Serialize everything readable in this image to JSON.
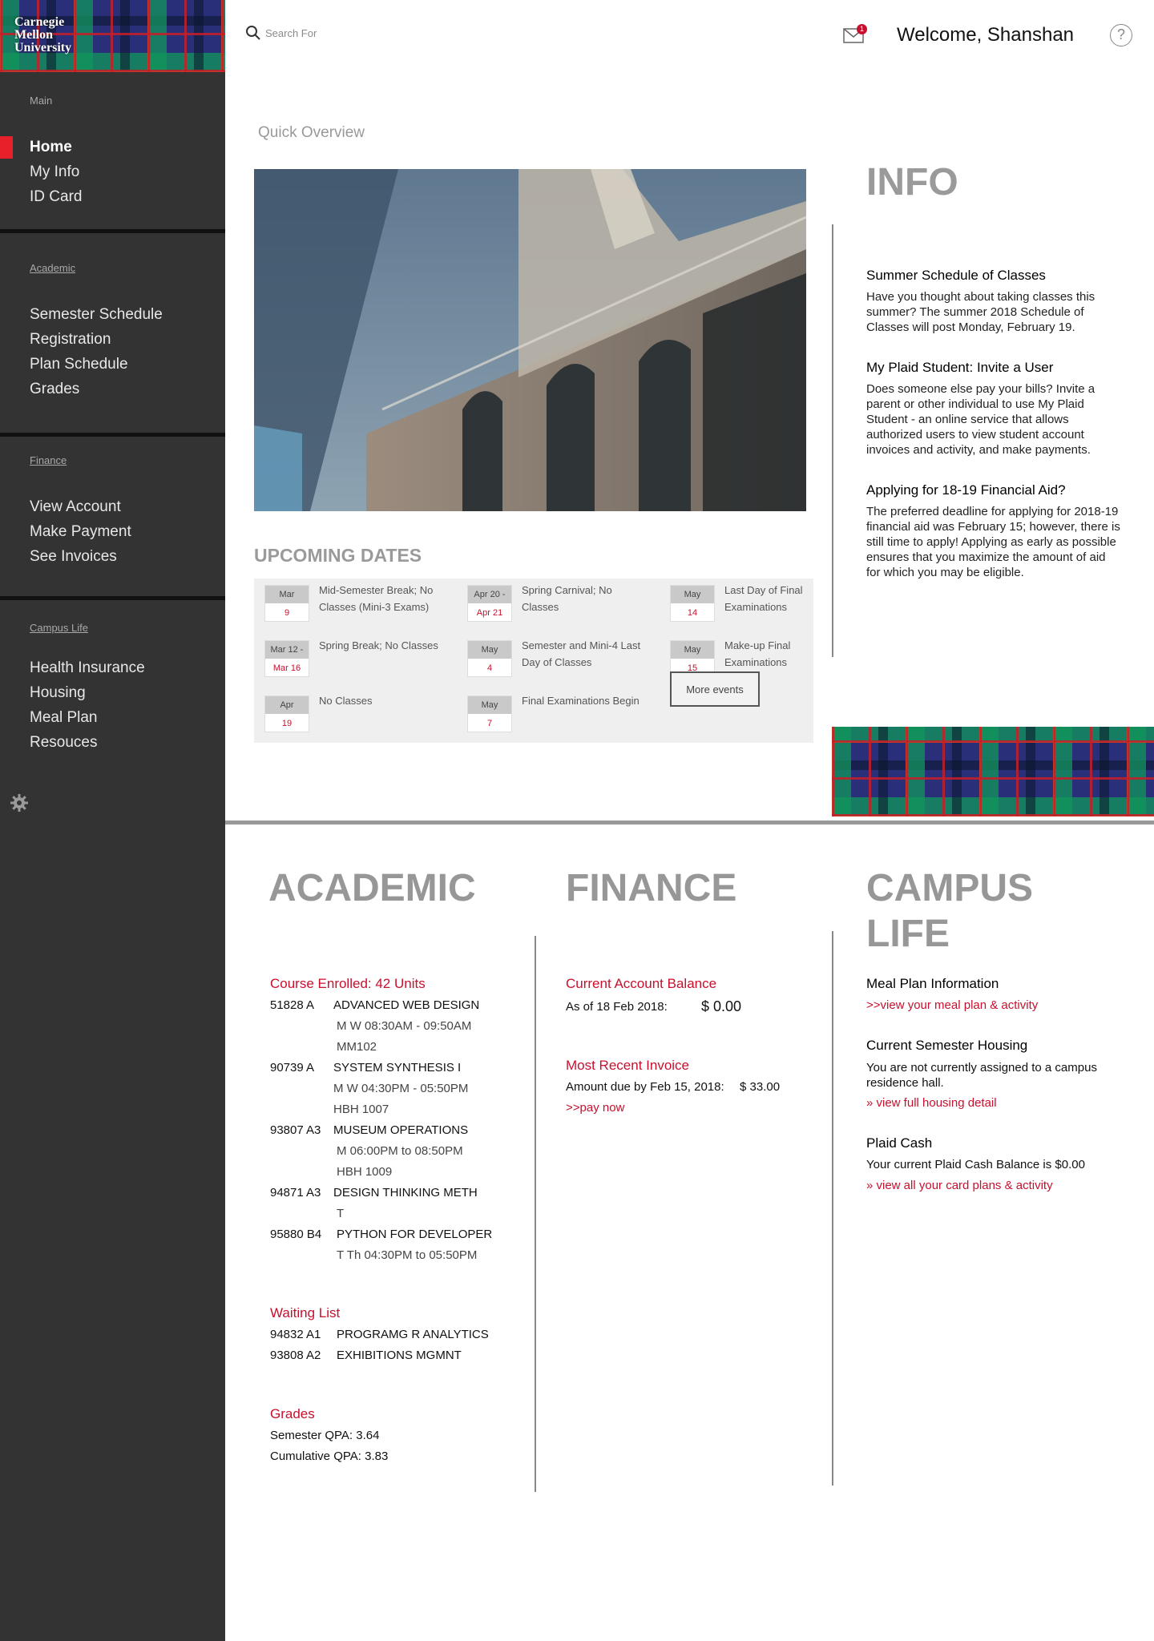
{
  "brand": {
    "logo_lines": [
      "Carnegie",
      "Mellon",
      "University"
    ]
  },
  "sidebar": {
    "main_title": "Main",
    "main_items": [
      "Home",
      "My Info",
      "ID Card"
    ],
    "academic_title": "Academic",
    "academic_items": [
      "Semester Schedule",
      "Registration",
      "Plan Schedule",
      "Grades"
    ],
    "finance_title": "Finance",
    "finance_items": [
      "View Account",
      "Make Payment",
      "See Invoices"
    ],
    "campus_title": "Campus Life",
    "campus_items": [
      "Health Insurance",
      "Housing",
      "Meal Plan",
      "Resouces"
    ],
    "accent": "#e8202a"
  },
  "header": {
    "search_placeholder": "Search For",
    "mail_count": "1",
    "welcome": "Welcome, Shanshan",
    "help": "?"
  },
  "overview": {
    "title": "Quick Overview",
    "upcoming_title": "UPCOMING DATES",
    "events": [
      {
        "mon": "Mar",
        "day": "9",
        "text": "Mid-Semester Break; No Classes (Mini-3 Exams)"
      },
      {
        "mon": "Apr 20 -",
        "day": "Apr 21",
        "text": "Spring Carnival; No Classes"
      },
      {
        "mon": "May",
        "day": "14",
        "text": "Last Day of Final Examinations"
      },
      {
        "mon": "Mar 12 -",
        "day": "Mar 16",
        "text": "Spring Break; No Classes"
      },
      {
        "mon": "May",
        "day": "4",
        "text": "Semester and Mini-4 Last Day of Classes"
      },
      {
        "mon": "May",
        "day": "15",
        "text": "Make-up Final Examinations"
      },
      {
        "mon": "Apr",
        "day": "19",
        "text": "No Classes"
      },
      {
        "mon": "May",
        "day": "7",
        "text": "Final Examinations Begin"
      }
    ],
    "more_events": "More events"
  },
  "info": {
    "title": "INFO",
    "items": [
      {
        "title": "Summer Schedule of Classes",
        "body": "Have you thought about taking classes this summer? The summer 2018 Schedule of Classes will post Monday, February 19."
      },
      {
        "title": "My Plaid Student: Invite a User",
        "body": "Does someone else pay your bills? Invite a parent or other individual to use My Plaid Student - an online service that allows authorized users to view student account invoices and activity, and make payments."
      },
      {
        "title": "Applying for 18-19 Financial Aid?",
        "body": "The preferred deadline for applying for 2018-19 financial aid was February 15; however, there is still time to apply! Applying as early as possible ensures that you maximize the amount of aid for which you may be eligible."
      }
    ]
  },
  "academic": {
    "title": "ACADEMIC",
    "enrolled_head": "Course Enrolled: 42 Units",
    "courses": [
      {
        "code": "51828 A",
        "name": "ADVANCED WEB DESIGN",
        "details": [
          "M W 08:30AM - 09:50AM",
          "MM102"
        ]
      },
      {
        "code": "90739 A",
        "name": "SYSTEM SYNTHESIS I",
        "details": [
          "M W  04:30PM - 05:50PM",
          "HBH 1007"
        ]
      },
      {
        "code": "93807 A3",
        "name": "MUSEUM OPERATIONS",
        "details": [
          "M 06:00PM to 08:50PM",
          "HBH 1009"
        ]
      },
      {
        "code": "94871 A3",
        "name": "DESIGN THINKING METH",
        "details": [
          "T"
        ]
      },
      {
        "code": "95880 B4",
        "name": "PYTHON FOR DEVELOPER",
        "details": [
          "T Th 04:30PM to 05:50PM"
        ]
      }
    ],
    "waiting_head": "Waiting List",
    "waiting": [
      {
        "code": "94832 A1",
        "name": "PROGRAMG R ANALYTICS"
      },
      {
        "code": "93808 A2",
        "name": "EXHIBITIONS MGMNT"
      }
    ],
    "grades_head": "Grades",
    "semester_qpa": "Semester QPA: 3.64",
    "cumulative_qpa": "Cumulative QPA: 3.83"
  },
  "finance": {
    "title": "FINANCE",
    "balance_head": "Current Account Balance",
    "balance_label": "As of 18 Feb 2018:",
    "balance_value": "$ 0.00",
    "invoice_head": "Most Recent Invoice",
    "invoice_label": "Amount due by Feb 15, 2018:",
    "invoice_value": "$ 33.00",
    "pay_link": ">>pay now"
  },
  "campus": {
    "title_line1": "CAMPUS",
    "title_line2": "LIFE",
    "meal_head": "Meal Plan Information",
    "meal_link": ">>view your meal plan & activity",
    "housing_head": "Current Semester Housing",
    "housing_body": "You are not currently assigned to a campus residence hall.",
    "housing_link": "» view full housing detail",
    "cash_head": "Plaid Cash",
    "cash_body": "Your current Plaid Cash Balance is $0.00",
    "cash_link": "» view all your card plans & activity"
  }
}
